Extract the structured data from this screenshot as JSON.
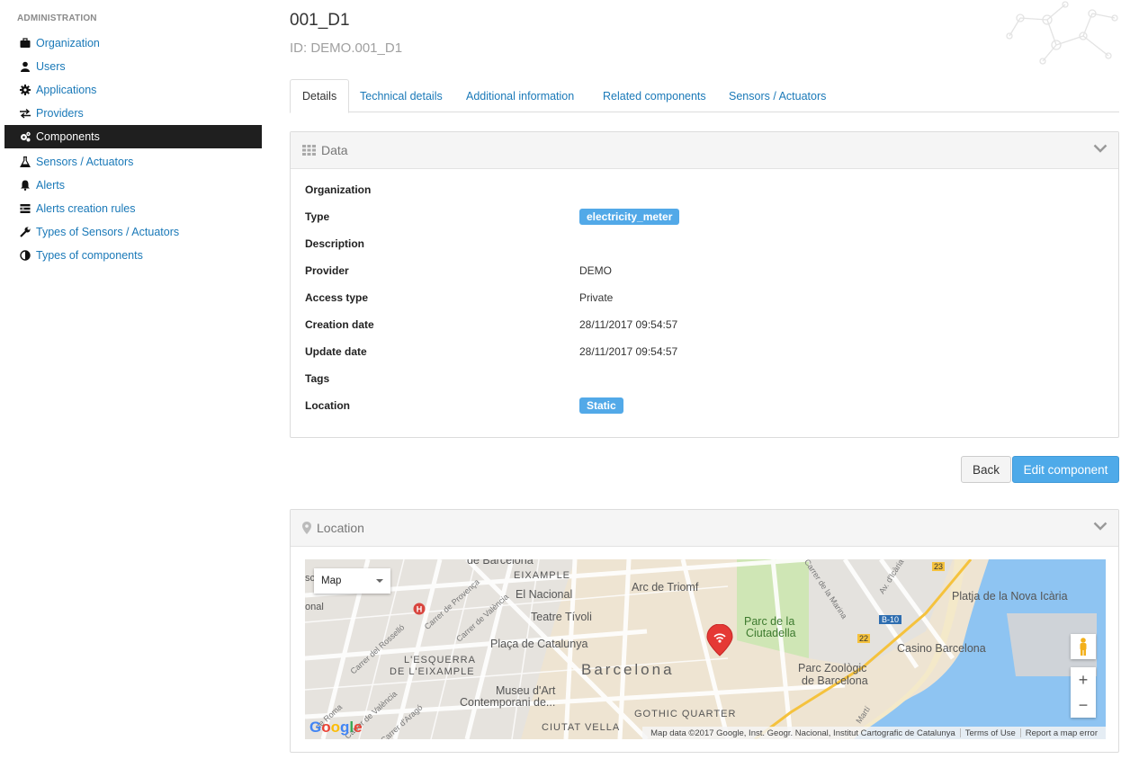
{
  "sidebar": {
    "heading": "ADMINISTRATION",
    "items": [
      {
        "label": "Organization",
        "icon": "briefcase-icon"
      },
      {
        "label": "Users",
        "icon": "user-icon"
      },
      {
        "label": "Applications",
        "icon": "gear-icon"
      },
      {
        "label": "Providers",
        "icon": "exchange-icon"
      },
      {
        "label": "Components",
        "icon": "gears-icon",
        "active": true
      },
      {
        "label": "Sensors / Actuators",
        "icon": "flask-icon"
      },
      {
        "label": "Alerts",
        "icon": "bell-icon"
      },
      {
        "label": "Alerts creation rules",
        "icon": "rules-icon"
      },
      {
        "label": "Types of Sensors / Actuators",
        "icon": "wrench-icon"
      },
      {
        "label": "Types of components",
        "icon": "contrast-icon"
      }
    ]
  },
  "header": {
    "title": "001_D1",
    "subtitle": "ID: DEMO.001_D1"
  },
  "tabs": [
    {
      "label": "Details",
      "active": true
    },
    {
      "label": "Technical details"
    },
    {
      "label": "Additional information"
    },
    {
      "label": "Related components"
    },
    {
      "label": "Sensors / Actuators"
    }
  ],
  "data_panel": {
    "title": "Data",
    "rows": [
      {
        "label": "Organization",
        "value": ""
      },
      {
        "label": "Type",
        "value": "electricity_meter",
        "badge": true
      },
      {
        "label": "Description",
        "value": ""
      },
      {
        "label": "Provider",
        "value": "DEMO"
      },
      {
        "label": "Access type",
        "value": "Private"
      },
      {
        "label": "Creation date",
        "value": "28/11/2017 09:54:57"
      },
      {
        "label": "Update date",
        "value": "28/11/2017 09:54:57"
      },
      {
        "label": "Tags",
        "value": ""
      },
      {
        "label": "Location",
        "value": "Static",
        "badge": true
      }
    ]
  },
  "actions": {
    "back_label": "Back",
    "edit_label": "Edit component"
  },
  "location_panel": {
    "title": "Location",
    "map": {
      "type_selector": "Map",
      "zoom_in": "+",
      "zoom_out": "−",
      "google_logo": "Google",
      "attribution": "Map data ©2017 Google, Inst. Geogr. Nacional, Institut Cartografic de Catalunya",
      "terms": "Terms of Use",
      "report": "Report a map error",
      "labels": {
        "barcelona_top": "de Barcelona",
        "eixample": "EIXAMPLE",
        "el_nacional": "El Nacional",
        "arc": "Arc de Triomf",
        "platja": "Platja de la Nova Icària",
        "teatre": "Teatre Tívoli",
        "parc_ciutadella_1": "Parc de la",
        "parc_ciutadella_2": "Ciutadella",
        "placa": "Plaça de Catalunya",
        "casino": "Casino Barcelona",
        "esquerra_1": "L'ESQUERRA",
        "esquerra_2": "DE L'EIXAMPLE",
        "barcelona": "Barcelona",
        "zoo_1": "Parc Zoològic",
        "zoo_2": "de Barcelona",
        "museu_1": "Museu d'Art",
        "museu_2": "Contemporani de...",
        "gothic": "GOTHIC QUARTER",
        "ciutat": "CIUTAT VELLA",
        "b10": "B-10",
        "n22": "22",
        "n23": "23",
        "sc": "sc",
        "onal": "onal",
        "marina": "Carrer de la Marina",
        "icaria": "Av. d'Icària",
        "rossello": "Carrer del Rosselló",
        "provenca": "Carrer de Provença",
        "valencia": "Carrer de València",
        "valencia2": "Carrer de València",
        "arago": "Carrer d'Aragó",
        "roma": "de Roma",
        "marti": "Martí"
      }
    }
  },
  "colors": {
    "link": "#1a79b8",
    "badge": "#52a9e8",
    "active_sidebar": "#1f1f1f",
    "primary_button": "#4eaae9",
    "map_marker": "#e53935"
  }
}
